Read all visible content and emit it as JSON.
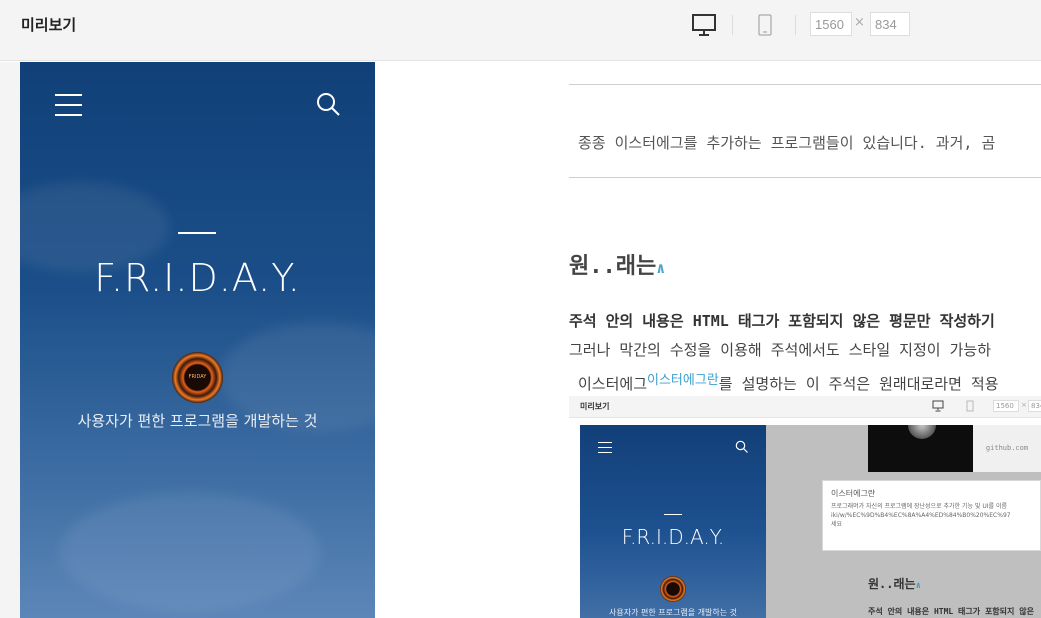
{
  "toolbar": {
    "title": "미리보기",
    "desktop_icon": "desktop-monitor-icon",
    "mobile_icon": "mobile-phone-icon",
    "width_value": "1560",
    "separator": "×",
    "height_value": "834"
  },
  "hero": {
    "menu_icon": "hamburger-menu-icon",
    "search_icon": "search-icon",
    "title": "F.R.I.D.A.Y.",
    "logo_text": "FRIDAY",
    "subtitle": "사용자가 편한 프로그램을 개발하는 것"
  },
  "article": {
    "intro": "종종 이스터에그를 추가하는 프로그램들이 있습니다. 과거, 곰",
    "heading": "원..래는",
    "heading_anchor": "∧",
    "line1": "주석 안의 내용은 HTML 태그가 포함되지 않은 평문만 작성하기",
    "line2": "그러나 막간의 수정을 이용해 주석에서도 스타일 지정이 가능하",
    "line3_before": "이스터에그",
    "line3_footnote": "이스터에그란",
    "line3_after": "를 설명하는 이 주석은 원래대로라면 적용"
  },
  "embedded_screenshot": {
    "title": "미리보기",
    "width_value": "1560",
    "separator": "×",
    "height_value": "834",
    "hero_title": "F.R.I.D.A.Y.",
    "hero_subtitle": "사용자가 편한 프로그램을 개발하는 것",
    "link_text": "github.com",
    "tooltip_title": "이스터에그란",
    "tooltip_line1": "프로그래머가 자신의 프로그램에 장난성으로 추가한 기능 및 UI를 이름",
    "tooltip_line2": "iki/w/%EC%9D%B4%EC%8A%A4%ED%84%B0%20%EC%97",
    "tooltip_line3": "세요",
    "heading": "원..래는",
    "heading_anchor": "∧",
    "line1": "주석 안의 내용은 HTML 태그가 포함되지 않은"
  }
}
